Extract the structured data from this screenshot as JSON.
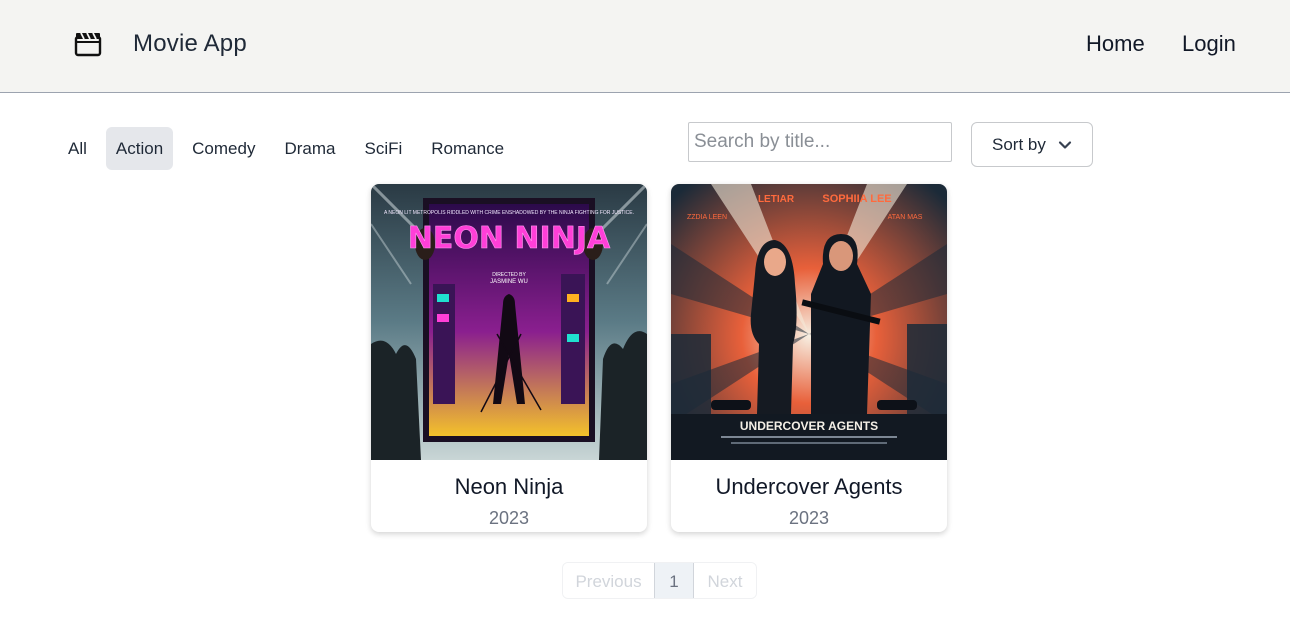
{
  "header": {
    "app_title": "Movie App",
    "logo_icon": "clapperboard-icon",
    "nav": {
      "home": "Home",
      "login": "Login"
    }
  },
  "filters": {
    "genres": [
      "All",
      "Action",
      "Comedy",
      "Drama",
      "SciFi",
      "Romance"
    ],
    "selected": "Action"
  },
  "search": {
    "placeholder": "Search by title...",
    "value": ""
  },
  "sort": {
    "label": "Sort by",
    "icon": "chevron-down-icon"
  },
  "movies": [
    {
      "title": "Neon Ninja",
      "year": "2023",
      "poster": {
        "headline": "NEON NINJA",
        "tagline": "A NEON LIT METROPOLIS RIDDLED WITH CRIME ENSHADOWED BY THE NINJA FIGHTING FOR JUSTICE.",
        "credit_line1": "DIRECTED BY",
        "credit_line2": "JASMINE WU"
      }
    },
    {
      "title": "Undercover Agents",
      "year": "2023",
      "poster": {
        "headline": "UNDERCOVER AGENTS",
        "star_left": "LETIAR",
        "star_right": "SOPHIIA LEE",
        "sub_left": "ZZDIA LEEN",
        "sub_right": "ATAN MAS"
      }
    }
  ],
  "pagination": {
    "previous": "Previous",
    "current": "1",
    "next": "Next"
  },
  "colors": {
    "header_bg": "#f4f4f2",
    "active_filter_bg": "#e5e7eb",
    "neon_pink": "#ff3fd8"
  }
}
